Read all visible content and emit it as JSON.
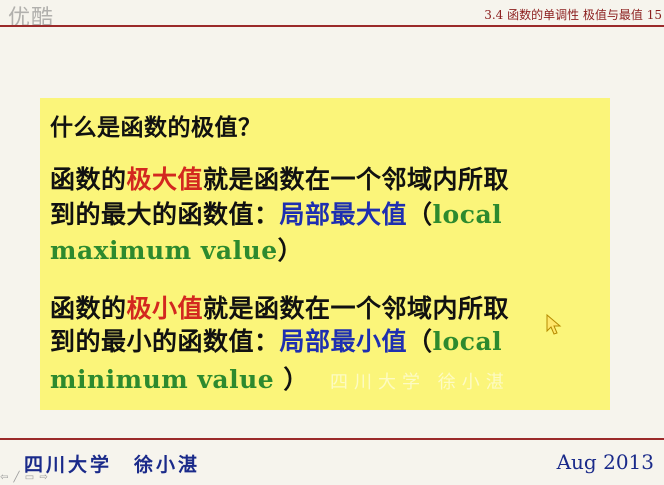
{
  "watermark": {
    "logo": "优酷",
    "faint": "四川大学  徐小湛"
  },
  "header": {
    "title": "3.4 函数的单调性 极值与最值 15"
  },
  "content": {
    "question": "什么是函数的极值？",
    "para1": {
      "line1_pre": "函数的",
      "line1_red": "极大值",
      "line1_post": "就是函数在一个邻域内所取",
      "line2_pre": "到的最大的函数值：",
      "line2_blue": "局部最大值",
      "line2_paren": "（",
      "line2_green": "local",
      "line3_green": "maximum value",
      "line3_paren": "）"
    },
    "para2": {
      "line1_pre": "函数的",
      "line1_red": "极小值",
      "line1_post": "就是函数在一个邻域内所取",
      "line2_pre": "到的最小的函数值：",
      "line2_blue": "局部最小值",
      "line2_paren": "（",
      "line2_green": "local",
      "line3_green": "minimum value",
      "line3_paren": " ）"
    }
  },
  "footer": {
    "left": "四川大学　徐小湛",
    "right": "Aug 2013"
  },
  "nav": {
    "controls": "⇦ ╱ ▭ ⇨"
  },
  "colors": {
    "background": "#f6f4ed",
    "box": "#fbf57a",
    "red_term": "#d3281f",
    "blue_term": "#1e2fb0",
    "green_term": "#2d8a2e",
    "rule": "#9b2a2a"
  }
}
